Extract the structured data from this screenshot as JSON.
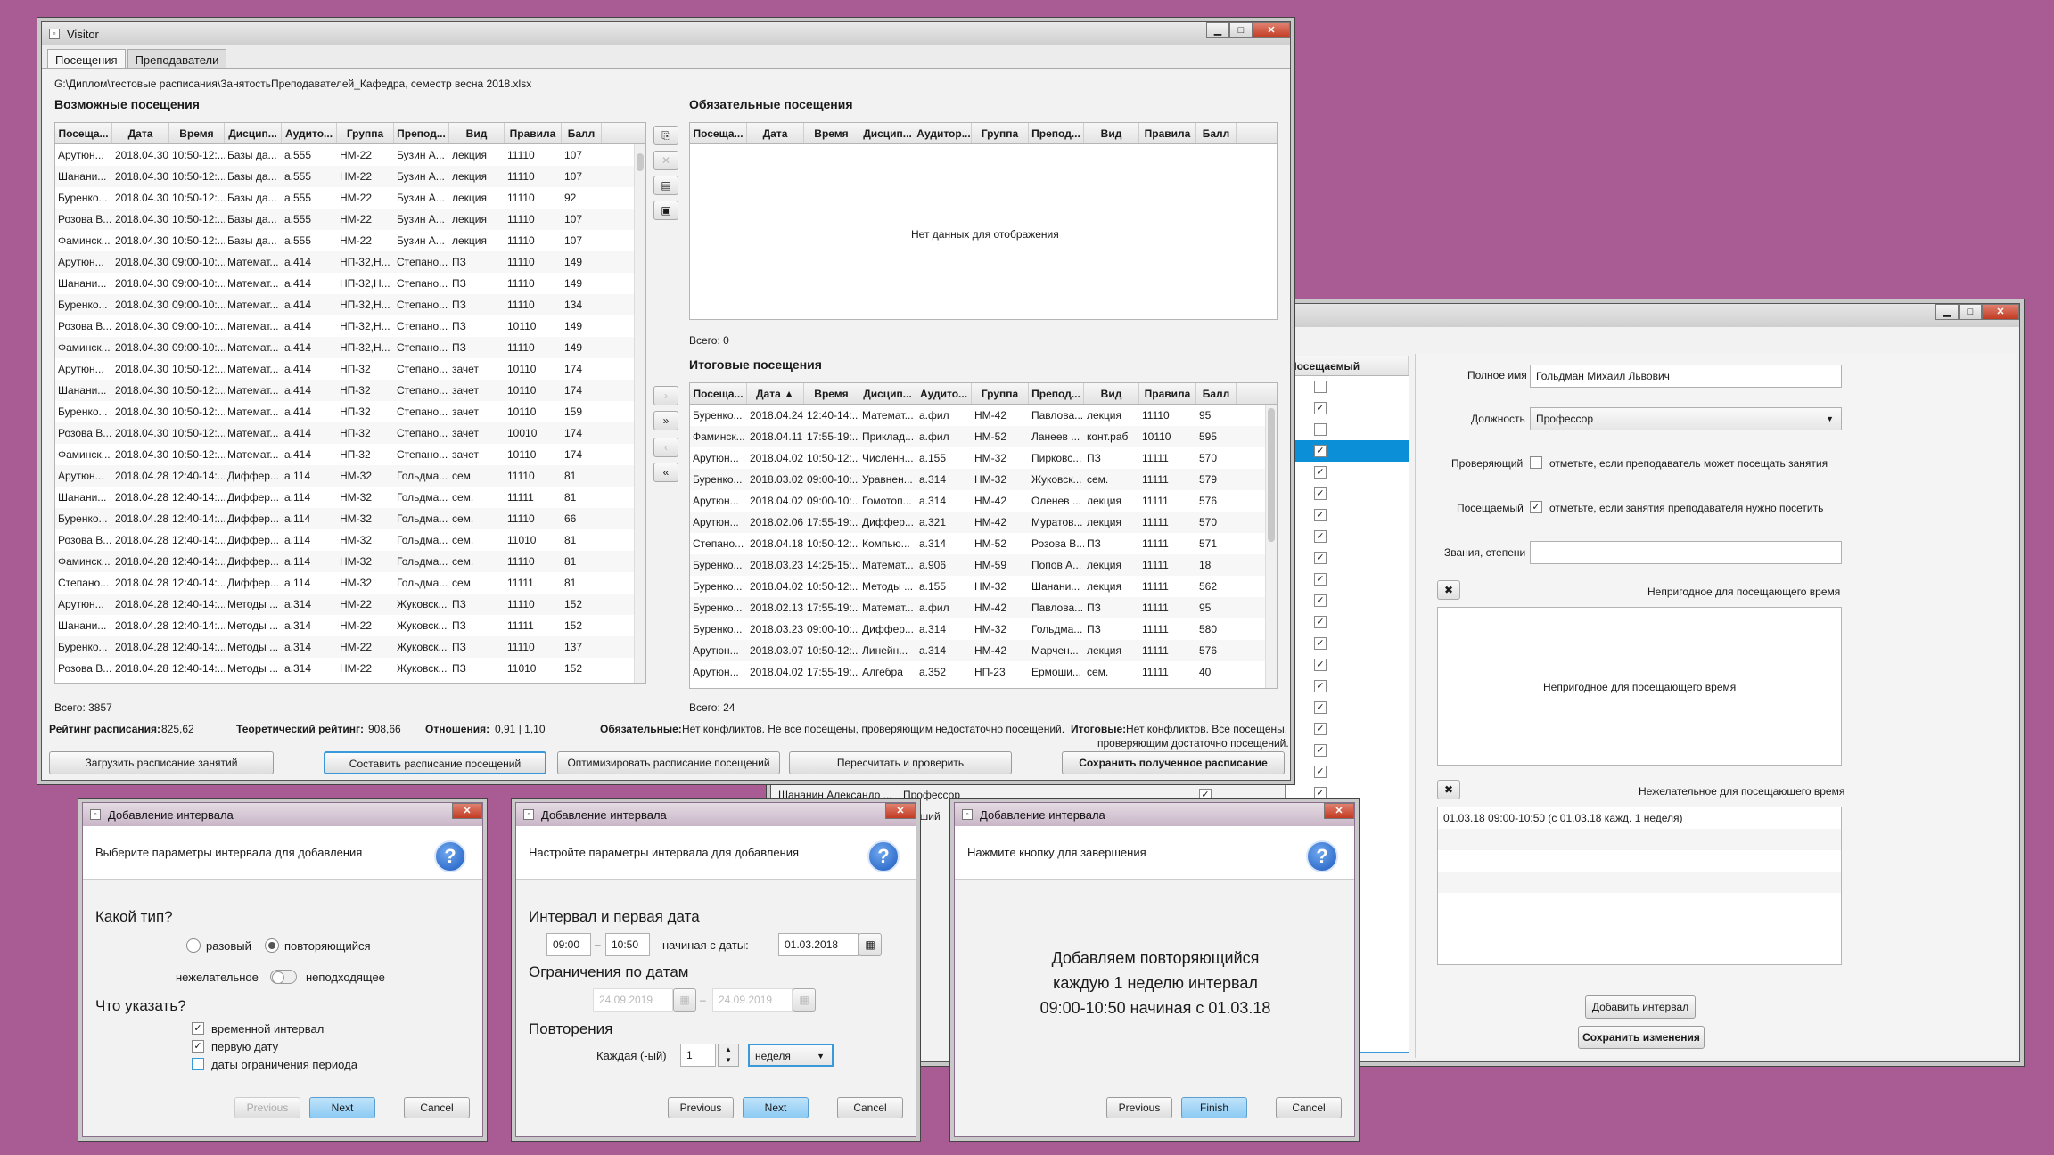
{
  "visitor": {
    "title": "Visitor",
    "tabs": [
      "Посещения",
      "Преподаватели"
    ],
    "file_path": "G:\\Диплом\\тестовые расписания\\ЗанятостьПреподавателей_Кафедра, семестр весна 2018.xlsx",
    "possible": {
      "title": "Возможные посещения",
      "columns": [
        "Посеща...",
        "Дата",
        "Время",
        "Дисцип...",
        "Аудито...",
        "Группа",
        "Препод...",
        "Вид",
        "Правила",
        "Балл"
      ],
      "rows": [
        [
          "Арутюн...",
          "2018.04.30",
          "10:50-12:...",
          "Базы да...",
          "а.555",
          "НМ-22",
          "Бузин А...",
          "лекция",
          "11110",
          "107"
        ],
        [
          "Шанани...",
          "2018.04.30",
          "10:50-12:...",
          "Базы да...",
          "а.555",
          "НМ-22",
          "Бузин А...",
          "лекция",
          "11110",
          "107"
        ],
        [
          "Буренко...",
          "2018.04.30",
          "10:50-12:...",
          "Базы да...",
          "а.555",
          "НМ-22",
          "Бузин А...",
          "лекция",
          "11110",
          "92"
        ],
        [
          "Розова В...",
          "2018.04.30",
          "10:50-12:...",
          "Базы да...",
          "а.555",
          "НМ-22",
          "Бузин А...",
          "лекция",
          "11110",
          "107"
        ],
        [
          "Фаминск...",
          "2018.04.30",
          "10:50-12:...",
          "Базы да...",
          "а.555",
          "НМ-22",
          "Бузин А...",
          "лекция",
          "11110",
          "107"
        ],
        [
          "Арутюн...",
          "2018.04.30",
          "09:00-10:...",
          "Математ...",
          "а.414",
          "НП-32,Н...",
          "Степано...",
          "ПЗ",
          "11110",
          "149"
        ],
        [
          "Шанани...",
          "2018.04.30",
          "09:00-10:...",
          "Математ...",
          "а.414",
          "НП-32,Н...",
          "Степано...",
          "ПЗ",
          "11110",
          "149"
        ],
        [
          "Буренко...",
          "2018.04.30",
          "09:00-10:...",
          "Математ...",
          "а.414",
          "НП-32,Н...",
          "Степано...",
          "ПЗ",
          "11110",
          "134"
        ],
        [
          "Розова В...",
          "2018.04.30",
          "09:00-10:...",
          "Математ...",
          "а.414",
          "НП-32,Н...",
          "Степано...",
          "ПЗ",
          "10110",
          "149"
        ],
        [
          "Фаминск...",
          "2018.04.30",
          "09:00-10:...",
          "Математ...",
          "а.414",
          "НП-32,Н...",
          "Степано...",
          "ПЗ",
          "11110",
          "149"
        ],
        [
          "Арутюн...",
          "2018.04.30",
          "10:50-12:...",
          "Математ...",
          "а.414",
          "НП-32",
          "Степано...",
          "зачет",
          "10110",
          "174"
        ],
        [
          "Шанани...",
          "2018.04.30",
          "10:50-12:...",
          "Математ...",
          "а.414",
          "НП-32",
          "Степано...",
          "зачет",
          "10110",
          "174"
        ],
        [
          "Буренко...",
          "2018.04.30",
          "10:50-12:...",
          "Математ...",
          "а.414",
          "НП-32",
          "Степано...",
          "зачет",
          "10110",
          "159"
        ],
        [
          "Розова В...",
          "2018.04.30",
          "10:50-12:...",
          "Математ...",
          "а.414",
          "НП-32",
          "Степано...",
          "зачет",
          "10010",
          "174"
        ],
        [
          "Фаминск...",
          "2018.04.30",
          "10:50-12:...",
          "Математ...",
          "а.414",
          "НП-32",
          "Степано...",
          "зачет",
          "10110",
          "174"
        ],
        [
          "Арутюн...",
          "2018.04.28",
          "12:40-14:...",
          "Диффер...",
          "а.114",
          "НМ-32",
          "Гольдма...",
          "сем.",
          "11110",
          "81"
        ],
        [
          "Шанани...",
          "2018.04.28",
          "12:40-14:...",
          "Диффер...",
          "а.114",
          "НМ-32",
          "Гольдма...",
          "сем.",
          "11111",
          "81"
        ],
        [
          "Буренко...",
          "2018.04.28",
          "12:40-14:...",
          "Диффер...",
          "а.114",
          "НМ-32",
          "Гольдма...",
          "сем.",
          "11110",
          "66"
        ],
        [
          "Розова В...",
          "2018.04.28",
          "12:40-14:...",
          "Диффер...",
          "а.114",
          "НМ-32",
          "Гольдма...",
          "сем.",
          "11010",
          "81"
        ],
        [
          "Фаминск...",
          "2018.04.28",
          "12:40-14:...",
          "Диффер...",
          "а.114",
          "НМ-32",
          "Гольдма...",
          "сем.",
          "11110",
          "81"
        ],
        [
          "Степано...",
          "2018.04.28",
          "12:40-14:...",
          "Диффер...",
          "а.114",
          "НМ-32",
          "Гольдма...",
          "сем.",
          "11111",
          "81"
        ],
        [
          "Арутюн...",
          "2018.04.28",
          "12:40-14:...",
          "Методы ...",
          "а.314",
          "НМ-22",
          "Жуковск...",
          "ПЗ",
          "11110",
          "152"
        ],
        [
          "Шанани...",
          "2018.04.28",
          "12:40-14:...",
          "Методы ...",
          "а.314",
          "НМ-22",
          "Жуковск...",
          "ПЗ",
          "11111",
          "152"
        ],
        [
          "Буренко...",
          "2018.04.28",
          "12:40-14:...",
          "Методы ...",
          "а.314",
          "НМ-22",
          "Жуковск...",
          "ПЗ",
          "11110",
          "137"
        ],
        [
          "Розова В...",
          "2018.04.28",
          "12:40-14:...",
          "Методы ...",
          "а.314",
          "НМ-22",
          "Жуковск...",
          "ПЗ",
          "11010",
          "152"
        ]
      ],
      "total": "Всего: 3857"
    },
    "mandatory": {
      "title": "Обязательные посещения",
      "columns": [
        "Посеща...",
        "Дата",
        "Время",
        "Дисцип...",
        "Аудитор...",
        "Группа",
        "Препод...",
        "Вид",
        "Правила",
        "Балл"
      ],
      "empty": "Нет данных для отображения",
      "total": "Всего: 0"
    },
    "final": {
      "title": "Итоговые посещения",
      "columns": [
        "Посеща...",
        "Дата ▲",
        "Время",
        "Дисцип...",
        "Аудито...",
        "Группа",
        "Препод...",
        "Вид",
        "Правила",
        "Балл"
      ],
      "rows": [
        [
          "Буренко...",
          "2018.04.24",
          "12:40-14:...",
          "Матемaт...",
          "а.фил",
          "НМ-42",
          "Павлова...",
          "лекция",
          "11110",
          "95"
        ],
        [
          "Фаминск...",
          "2018.04.11",
          "17:55-19:...",
          "Приклад...",
          "а.фил",
          "НМ-52",
          "Ланеев ...",
          "конт.раб",
          "10110",
          "595"
        ],
        [
          "Арутюн...",
          "2018.04.02",
          "10:50-12:...",
          "Численн...",
          "а.155",
          "НМ-32",
          "Пирковс...",
          "ПЗ",
          "11111",
          "570"
        ],
        [
          "Буренко...",
          "2018.03.02",
          "09:00-10:...",
          "Уравнен...",
          "а.314",
          "НМ-32",
          "Жуковск...",
          "сем.",
          "11111",
          "579"
        ],
        [
          "Арутюн...",
          "2018.04.02",
          "09:00-10:...",
          "Гомотоп...",
          "а.314",
          "НМ-42",
          "Оленев ...",
          "лекция",
          "11111",
          "576"
        ],
        [
          "Арутюн...",
          "2018.02.06",
          "17:55-19:...",
          "Диффер...",
          "а.321",
          "НМ-42",
          "Муратов...",
          "лекция",
          "11111",
          "570"
        ],
        [
          "Степано...",
          "2018.04.18",
          "10:50-12:...",
          "Компью...",
          "а.314",
          "НМ-52",
          "Розова В...",
          "ПЗ",
          "11111",
          "571"
        ],
        [
          "Буренко...",
          "2018.03.23",
          "14:25-15:...",
          "Матемaт...",
          "а.906",
          "НМ-59",
          "Попов А...",
          "лекция",
          "11111",
          "18"
        ],
        [
          "Буренко...",
          "2018.04.02",
          "10:50-12:...",
          "Методы ...",
          "а.155",
          "НМ-32",
          "Шанани...",
          "лекция",
          "11111",
          "562"
        ],
        [
          "Буренко...",
          "2018.02.13",
          "17:55-19:...",
          "Матемaт...",
          "а.фил",
          "НМ-42",
          "Павлова...",
          "ПЗ",
          "11111",
          "95"
        ],
        [
          "Буренко...",
          "2018.03.23",
          "09:00-10:...",
          "Диффер...",
          "а.314",
          "НМ-32",
          "Гольдма...",
          "ПЗ",
          "11111",
          "580"
        ],
        [
          "Арутюн...",
          "2018.03.07",
          "10:50-12:...",
          "Линейн...",
          "а.314",
          "НМ-42",
          "Марчен...",
          "лекция",
          "11111",
          "576"
        ],
        [
          "Арутюн...",
          "2018.04.02",
          "17:55-19:...",
          "Алгебра",
          "а.352",
          "НП-23",
          "Ермоши...",
          "сем.",
          "11111",
          "40"
        ]
      ],
      "total": "Всего: 24"
    },
    "rating_label": "Рейтинг расписания:",
    "rating_value": "825,62",
    "theor_label": "Теоретический рейтинг:",
    "theor_value": "908,66",
    "ratio_label": "Отношения:",
    "ratio_value": "0,91 | 1,10",
    "status_mandatory_label": "Обязательные:",
    "status_mandatory_text": "Нет конфликтов. Не все посещены, проверяющим недостаточно посещений.",
    "status_final_label": "Итоговые:",
    "status_final_text": "Нет конфликтов. Все посещены,",
    "status_final_text2": "проверяющим достаточно посещений.",
    "buttons": {
      "load": "Загрузить расписание занятий",
      "compose": "Составить расписание посещений",
      "optimize": "Оптимизировать расписание посещений",
      "recalc": "Пересчитать и проверить",
      "save": "Сохранить полученное расписание"
    }
  },
  "teacher": {
    "column_visited": "Посещаемый",
    "checks": [
      false,
      true,
      false,
      true,
      true,
      true,
      true,
      true,
      true,
      true,
      true,
      true,
      true,
      true,
      true,
      true,
      true,
      true,
      true,
      true
    ],
    "bottom_row_name": "Шананин Александр ...",
    "bottom_row_pos": "Профессор",
    "bottom_row_tail": "рший",
    "full_name_label": "Полное имя",
    "full_name_value": "Гольдман Михаил Львович",
    "position_label": "Должность",
    "position_value": "Профессор",
    "checker_label": "Проверяющий",
    "checker_hint": "отметьте, если преподаватель может посещать занятия",
    "visited_label": "Посещаемый",
    "visited_hint": "отметьте, если занятия преподавателя нужно посетить",
    "titles_label": "Звания, степени",
    "titles_value": "",
    "unfit_label": "Непригодное для посещающего время",
    "unfit_empty": "Непригодное для посещающего время",
    "undesired_label": "Нежелательное для посещающего время",
    "undesired_items": [
      "01.03.18 09:00-10:50 (с 01.03.18 кажд. 1 неделя)"
    ],
    "add_interval": "Добавить интервал",
    "save_changes": "Сохранить изменения"
  },
  "dialog1": {
    "title": "Добавление интервала",
    "header": "Выберите параметры интервала для добавления",
    "type_question": "Какой тип?",
    "radio_once": "разовый",
    "radio_repeat": "повторяющийся",
    "toggle_left": "нежелательное",
    "toggle_right": "неподходящее",
    "what_question": "Что указать?",
    "check1": "временной интервал",
    "check2": "первую дату",
    "check3": "даты ограничения периода",
    "prev": "Previous",
    "next": "Next",
    "cancel": "Cancel"
  },
  "dialog2": {
    "title": "Добавление интервала",
    "header": "Настройте параметры интервала для добавления",
    "section1": "Интервал и первая дата",
    "time_from": "09:00",
    "time_to": "10:50",
    "starting_label": "начиная с даты:",
    "start_date": "01.03.2018",
    "section2": "Ограничения по датам",
    "limit_from": "24.09.2019",
    "limit_to": "24.09.2019",
    "section3": "Повторения",
    "each_label": "Каждая (-ый)",
    "each_value": "1",
    "period": "неделя",
    "prev": "Previous",
    "next": "Next",
    "cancel": "Cancel"
  },
  "dialog3": {
    "title": "Добавление интервала",
    "header": "Нажмите кнопку для завершения",
    "line1": "Добавляем повторяющийся",
    "line2": "каждую 1 неделю интервал",
    "line3": "09:00-10:50 начиная с 01.03.18",
    "prev": "Previous",
    "finish": "Finish",
    "cancel": "Cancel"
  }
}
